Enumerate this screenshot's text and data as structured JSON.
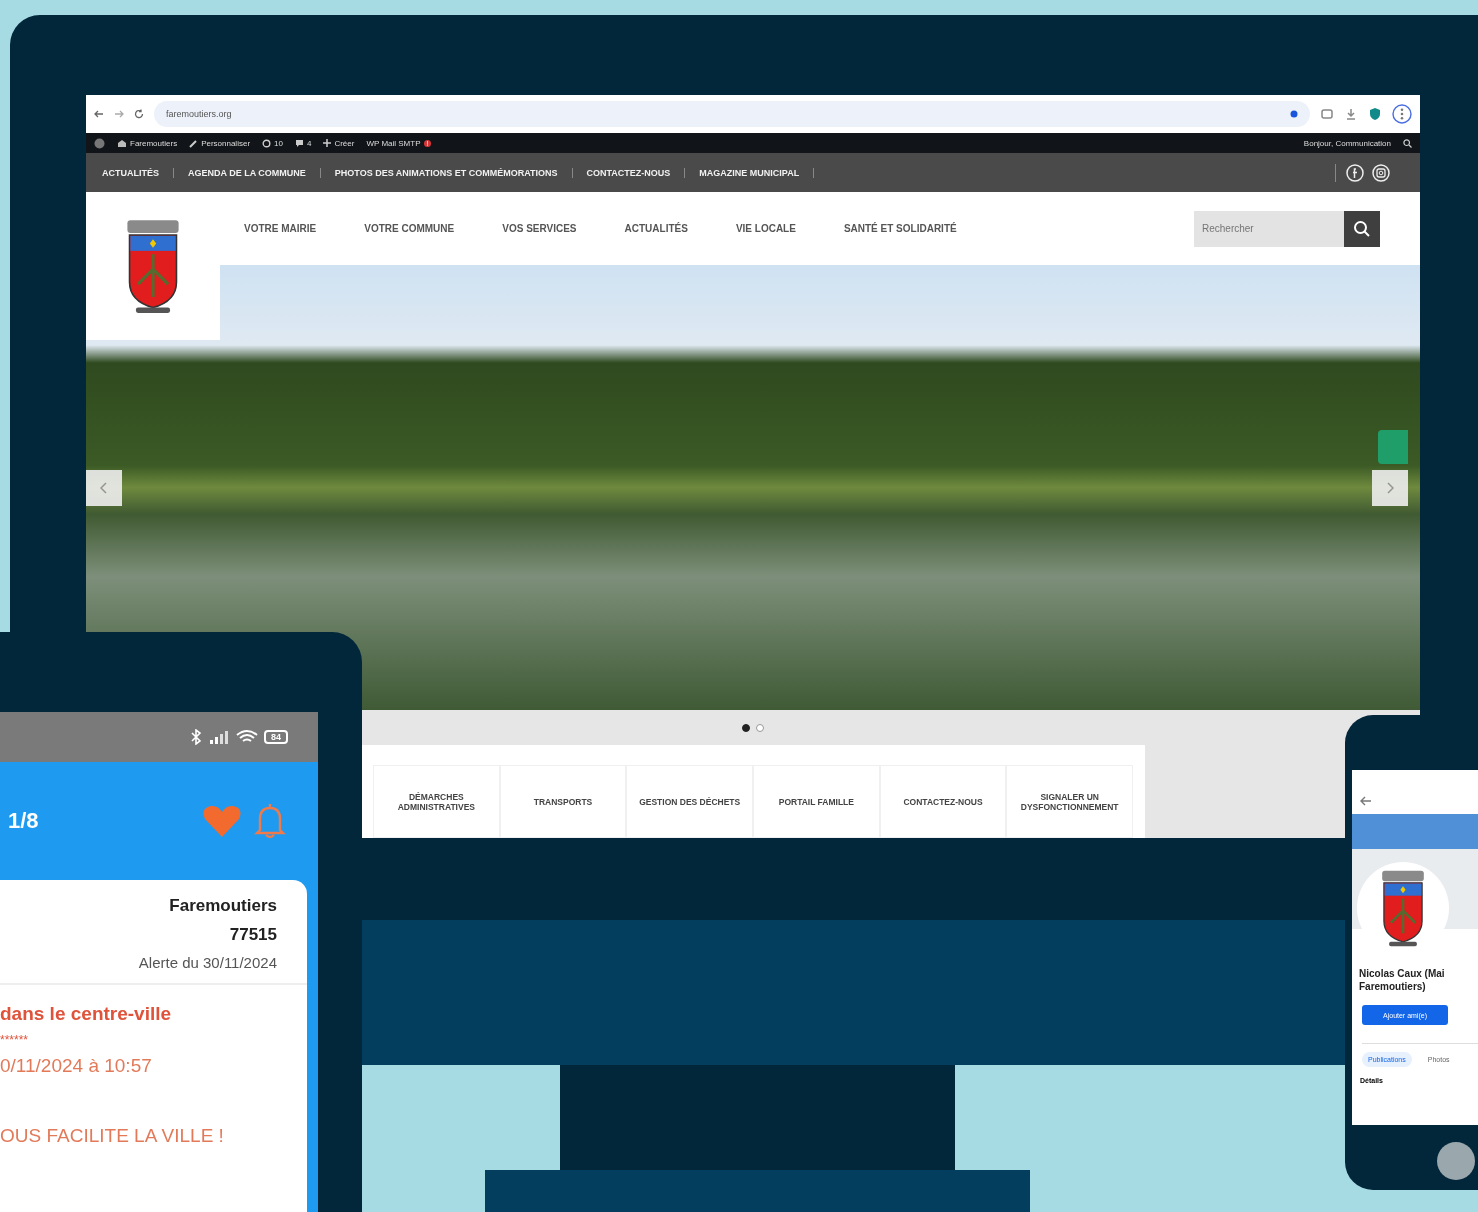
{
  "browser": {
    "url": "faremoutiers.org"
  },
  "admin_bar": {
    "items": [
      {
        "kind": "site",
        "label": "Faremoutiers"
      },
      {
        "kind": "edit",
        "label": "Personnaliser"
      },
      {
        "kind": "updates",
        "label": "10"
      },
      {
        "kind": "comments",
        "label": "4"
      },
      {
        "kind": "new",
        "label": "Créer"
      },
      {
        "kind": "plugin",
        "label": "WP Mail SMTP",
        "badge": "!"
      }
    ],
    "greeting": "Bonjour, Communication"
  },
  "top_menu": [
    "ACTUALITÉS",
    "AGENDA DE LA COMMUNE",
    "PHOTOS DES ANIMATIONS ET COMMÉMORATIONS",
    "CONTACTEZ-NOUS",
    "MAGAZINE MUNICIPAL"
  ],
  "main_nav": [
    "VOTRE MAIRIE",
    "VOTRE COMMUNE",
    "VOS SERVICES",
    "ACTUALITÉS",
    "VIE LOCALE",
    "SANTÉ ET SOLIDARITÉ"
  ],
  "search": {
    "placeholder": "Rechercher"
  },
  "slider": {
    "dots": [
      {
        "selected": true
      },
      {
        "selected": false
      }
    ]
  },
  "quick_links": [
    "DÉMARCHES ADMINISTRATIVES",
    "TRANSPORTS",
    "GESTION DES DÉCHETS",
    "PORTAIL FAMILLE",
    "CONTACTEZ-NOUS",
    "SIGNALER UN DYSFONCTIONNEMENT"
  ],
  "phone_left": {
    "battery": "84",
    "counter": "1/8",
    "card": {
      "city": "Faremoutiers",
      "postcode": "77515",
      "date": "Alerte du 30/11/2024"
    },
    "alert": {
      "title": "dans le centre-ville",
      "masked": "******",
      "datetime": "0/11/2024 à 10:57",
      "slogan": "OUS FACILITE LA VILLE !"
    }
  },
  "phone_right": {
    "name": [
      "Nicolas Caux (Mai",
      "Faremoutiers)"
    ],
    "button": "Ajouter ami(e)",
    "tabs": [
      {
        "label": "Publications",
        "selected": true
      },
      {
        "label": "Photos",
        "selected": false
      }
    ],
    "section": "Détails"
  }
}
